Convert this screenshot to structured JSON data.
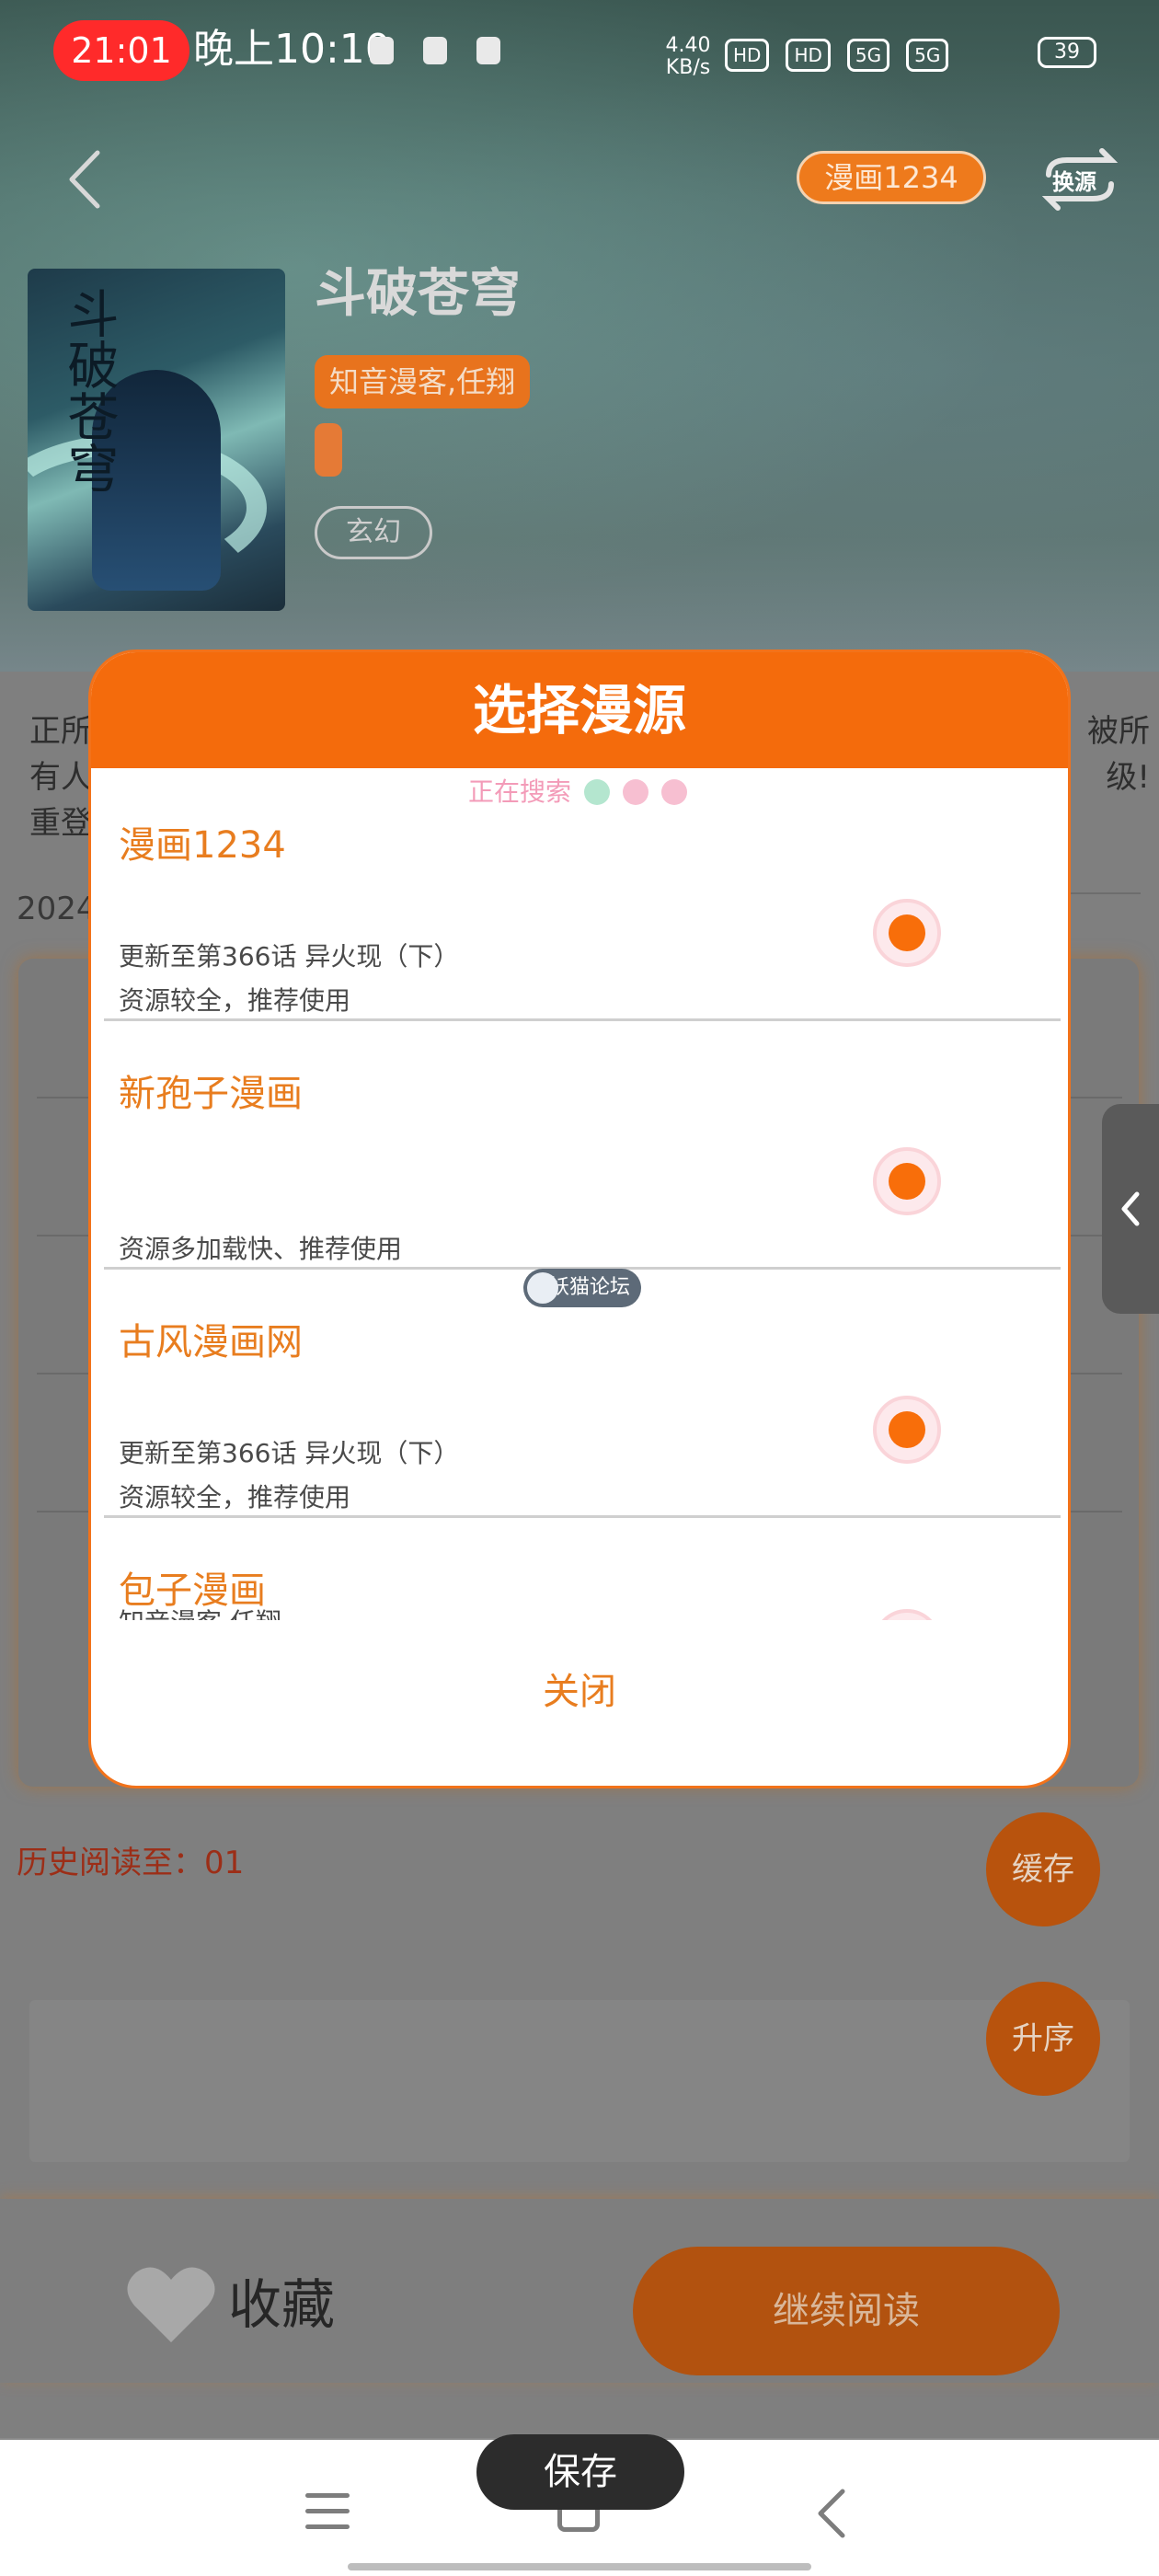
{
  "status_bar": {
    "recording_pill": "21:01",
    "time": "晚上10:10",
    "net_speed_value": "4.40",
    "net_speed_unit": "KB/s",
    "hd1": "HD",
    "hd2": "HD",
    "signal1": "5G",
    "signal2": "5G",
    "battery": "39"
  },
  "header": {
    "current_source": "漫画1234",
    "switch_source_label": "换源"
  },
  "comic": {
    "title": "斗破苍穹",
    "authors": "知音漫客,任翔",
    "genre": "玄幻",
    "cover_calligraphy": "斗破苍穹"
  },
  "description": {
    "left_lines": [
      "正所",
      "有人",
      "重登"
    ],
    "right_lines": [
      "被所",
      "级!"
    ],
    "date_prefix": "2024"
  },
  "history": {
    "label": "历史阅读至：01"
  },
  "fabs": {
    "cache": "缓存",
    "sort": "升序"
  },
  "bottom": {
    "favorite": "收藏",
    "continue": "继续阅读"
  },
  "modal": {
    "title": "选择漫源",
    "searching": "正在搜索",
    "items": [
      {
        "name": "漫画1234",
        "line1": "更新至第366话 异火现（下）",
        "line2": "资源较全，推荐使用"
      },
      {
        "name": "新孢子漫画",
        "line1": "",
        "line2": "资源多加载快、推荐使用"
      },
      {
        "name": "古风漫画网",
        "line1": "更新至第366话 异火现（下）",
        "line2": "资源较全，推荐使用"
      },
      {
        "name": "包子漫画",
        "line1": "知音漫客,任翔",
        "line2": ""
      }
    ],
    "close": "关闭",
    "watermark": "妖猫论坛"
  },
  "toast": "保存",
  "colors": {
    "accent": "#f46b0c",
    "source_name": "#e87d1f",
    "radio_fill": "#f86e0a",
    "history_red": "#9c2e17"
  }
}
